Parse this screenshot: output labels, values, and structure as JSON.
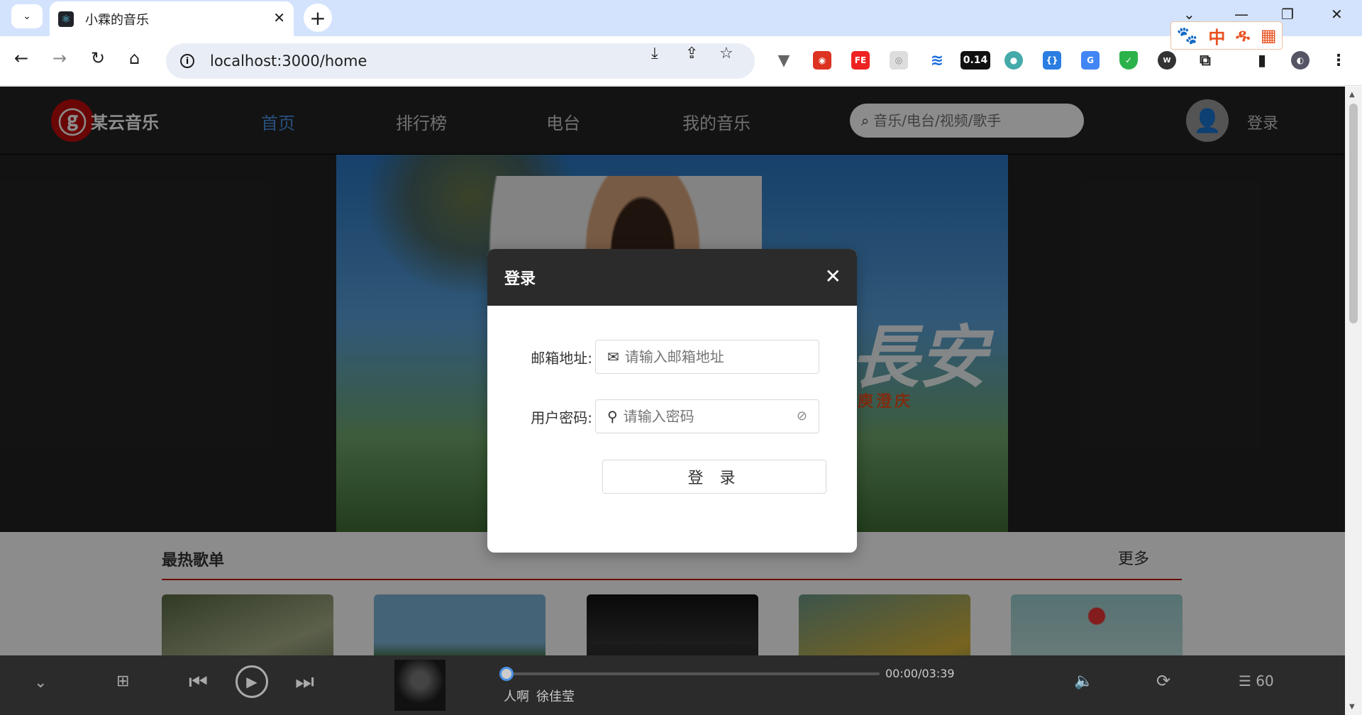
{
  "browser": {
    "tab_title": "小霖的音乐",
    "url": "localhost:3000/home",
    "ext_cls_value": "0.14",
    "popup_ext_items": [
      "🐾",
      "中",
      "ዱ",
      "▦"
    ]
  },
  "site": {
    "logo_text": "某云音乐",
    "nav": [
      "首页",
      "排行榜",
      "电台",
      "我的音乐"
    ],
    "search_placeholder": "音乐/电台/视频/歌手",
    "login_link": "登录"
  },
  "banner": {
    "art_text": "長安",
    "artist": "庾澄庆"
  },
  "hot": {
    "title": "最热歌单",
    "more": "更多"
  },
  "modal": {
    "title": "登录",
    "email_label": "邮箱地址",
    "email_placeholder": "请输入邮箱地址",
    "password_label": "用户密码",
    "password_placeholder": "请输入密码",
    "submit_label": "登 录"
  },
  "player": {
    "time": "00:00/03:39",
    "song": "人啊",
    "artist": "徐佳莹",
    "playlist_count": "60",
    "progress": 0
  },
  "colors": {
    "accent": "#4a90e2",
    "brand_red": "#c20c0c",
    "header_bg": "#242424"
  }
}
